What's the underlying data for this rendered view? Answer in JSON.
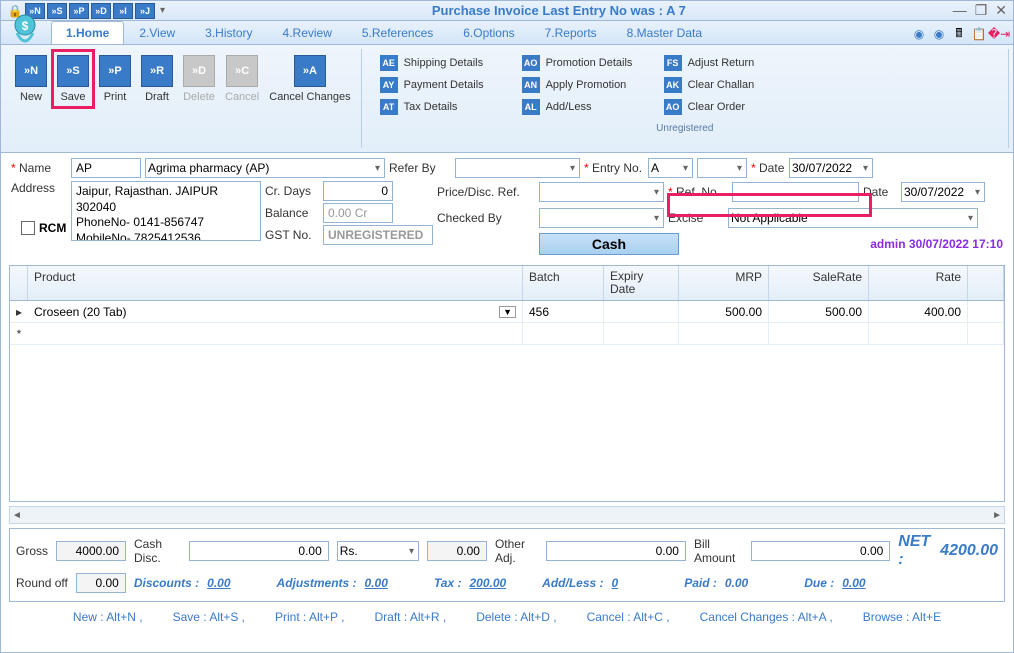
{
  "title": "Purchase Invoice     Last Entry No was : A 7",
  "qat": [
    "»N",
    "»S",
    "»P",
    "»D",
    "»I",
    "»J"
  ],
  "tabs": [
    "1.Home",
    "2.View",
    "3.History",
    "4.Review",
    "5.References",
    "6.Options",
    "7.Reports",
    "8.Master Data"
  ],
  "ribbon": {
    "buttons": [
      {
        "ico": "»N",
        "label": "New"
      },
      {
        "ico": "»S",
        "label": "Save"
      },
      {
        "ico": "»P",
        "label": "Print"
      },
      {
        "ico": "»R",
        "label": "Draft"
      },
      {
        "ico": "»D",
        "label": "Delete"
      },
      {
        "ico": "»C",
        "label": "Cancel"
      },
      {
        "ico": "»A",
        "label": "Cancel Changes"
      }
    ],
    "links": [
      [
        {
          "ico": "AE",
          "label": "Shipping Details"
        },
        {
          "ico": "AO",
          "label": "Promotion Details"
        },
        {
          "ico": "FS",
          "label": "Adjust Return"
        }
      ],
      [
        {
          "ico": "AY",
          "label": "Payment Details"
        },
        {
          "ico": "AN",
          "label": "Apply Promotion"
        },
        {
          "ico": "AK",
          "label": "Clear Challan"
        }
      ],
      [
        {
          "ico": "AT",
          "label": "Tax Details"
        },
        {
          "ico": "AL",
          "label": "Add/Less"
        },
        {
          "ico": "AO",
          "label": "Clear Order"
        }
      ]
    ],
    "group_label": "Unregistered"
  },
  "form": {
    "name_label": "Name",
    "name_code": "AP",
    "name_full": "Agrima pharmacy (AP)",
    "refer_label": "Refer By",
    "entry_label": "Entry No.",
    "entry_val": "A",
    "date_label": "Date",
    "date1": "30/07/2022",
    "date2": "30/07/2022",
    "addr_label": "Address",
    "addr": "Jaipur, Rajasthan.  JAIPUR\n302040\nPhoneNo- 0141-856747\nMobileNo- 7825412536",
    "crdays_label": "Cr. Days",
    "crdays": "0",
    "price_label": "Price/Disc. Ref.",
    "ref_label": "Ref. No.",
    "rcm_label": "RCM",
    "balance_label": "Balance",
    "balance": "0.00 Cr",
    "checked_label": "Checked By",
    "excise_label": "Excise",
    "excise": "Not Applicable",
    "gst_label": "GST No.",
    "gst": "UNREGISTERED",
    "cash": "Cash",
    "admin": "admin 30/07/2022 17:10"
  },
  "grid": {
    "headers": [
      "Product",
      "Batch",
      "Expiry Date",
      "MRP",
      "SaleRate",
      "Rate",
      ""
    ],
    "row": {
      "product": "Croseen (20 Tab)",
      "batch": "456",
      "expiry": "",
      "mrp": "500.00",
      "sale": "500.00",
      "rate": "400.00"
    }
  },
  "totals": {
    "gross_l": "Gross",
    "gross": "4000.00",
    "cashdisc_l": "Cash Disc.",
    "cashdisc": "0.00",
    "cashdisc_type": "Rs.",
    "cashdisc_amt": "0.00",
    "other_l": "Other Adj.",
    "other": "0.00",
    "bill_l": "Bill Amount",
    "bill": "0.00",
    "net_l": "NET :",
    "net": "4200.00",
    "round_l": "Round off",
    "round": "0.00",
    "disc_l": "Discounts :",
    "disc": "0.00",
    "adj_l": "Adjustments :",
    "adj": "0.00",
    "tax_l": "Tax :",
    "tax": "200.00",
    "addless_l": "Add/Less :",
    "addless": "0",
    "paid_l": "Paid :",
    "paid": "0.00",
    "due_l": "Due :",
    "due": "0.00"
  },
  "shortcuts": [
    "New : Alt+N ,",
    "Save : Alt+S ,",
    "Print : Alt+P ,",
    "Draft : Alt+R ,",
    "Delete : Alt+D ,",
    "Cancel : Alt+C ,",
    "Cancel Changes : Alt+A ,",
    "Browse : Alt+E"
  ]
}
